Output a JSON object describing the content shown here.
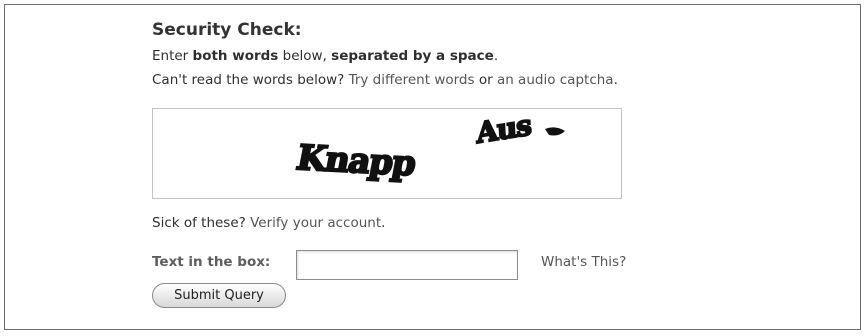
{
  "security": {
    "title": "Security Check:",
    "instruction": {
      "part1": "Enter ",
      "bold1": "both words",
      "part2": " below, ",
      "bold2": "separated by a space",
      "part3": "."
    },
    "cant_read": {
      "prefix": "Can't read the words below? ",
      "link1": "Try different words",
      "middle": " or ",
      "link2": "an audio captcha",
      "suffix": "."
    },
    "captcha": {
      "word1": "Knapp",
      "word2": "Aus"
    },
    "sick": {
      "prefix": "Sick of these? ",
      "link": "Verify your account",
      "suffix": "."
    }
  },
  "form": {
    "label": "Text in the box:",
    "input_value": "",
    "whats_this": "What's This?",
    "submit_label": "Submit Query"
  }
}
